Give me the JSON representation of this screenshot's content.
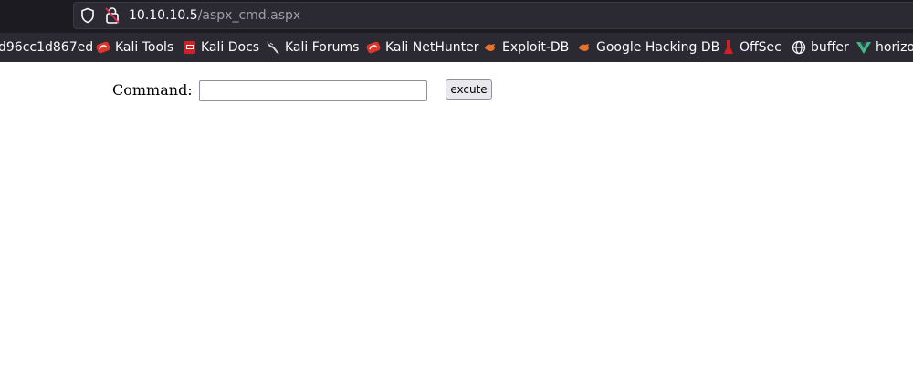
{
  "browser": {
    "url_host": "10.10.10.5",
    "url_path": "/aspx_cmd.aspx",
    "bookmarks": [
      {
        "label": "d96cc1d867ed",
        "icon": "none"
      },
      {
        "label": "Kali Tools",
        "icon": "kali-icon"
      },
      {
        "label": "Kali Docs",
        "icon": "kali-docs-icon"
      },
      {
        "label": "Kali Forums",
        "icon": "kali-dragon-icon"
      },
      {
        "label": "Kali NetHunter",
        "icon": "kali-icon"
      },
      {
        "label": "Exploit-DB",
        "icon": "exploit-db-icon"
      },
      {
        "label": "Google Hacking DB",
        "icon": "exploit-db-icon"
      },
      {
        "label": "OffSec",
        "icon": "offsec-icon"
      },
      {
        "label": "buffer",
        "icon": "globe-icon"
      },
      {
        "label": "horizo",
        "icon": "vue-icon"
      }
    ]
  },
  "form": {
    "command_label": "Command:",
    "command_value": "",
    "execute_label": "excute"
  },
  "colors": {
    "chrome_bg": "#1c1b22",
    "toolbar_bg": "#2b2a33",
    "kali_red": "#e0352b",
    "exploit_orange": "#e8702a",
    "vue_green": "#41b883"
  }
}
